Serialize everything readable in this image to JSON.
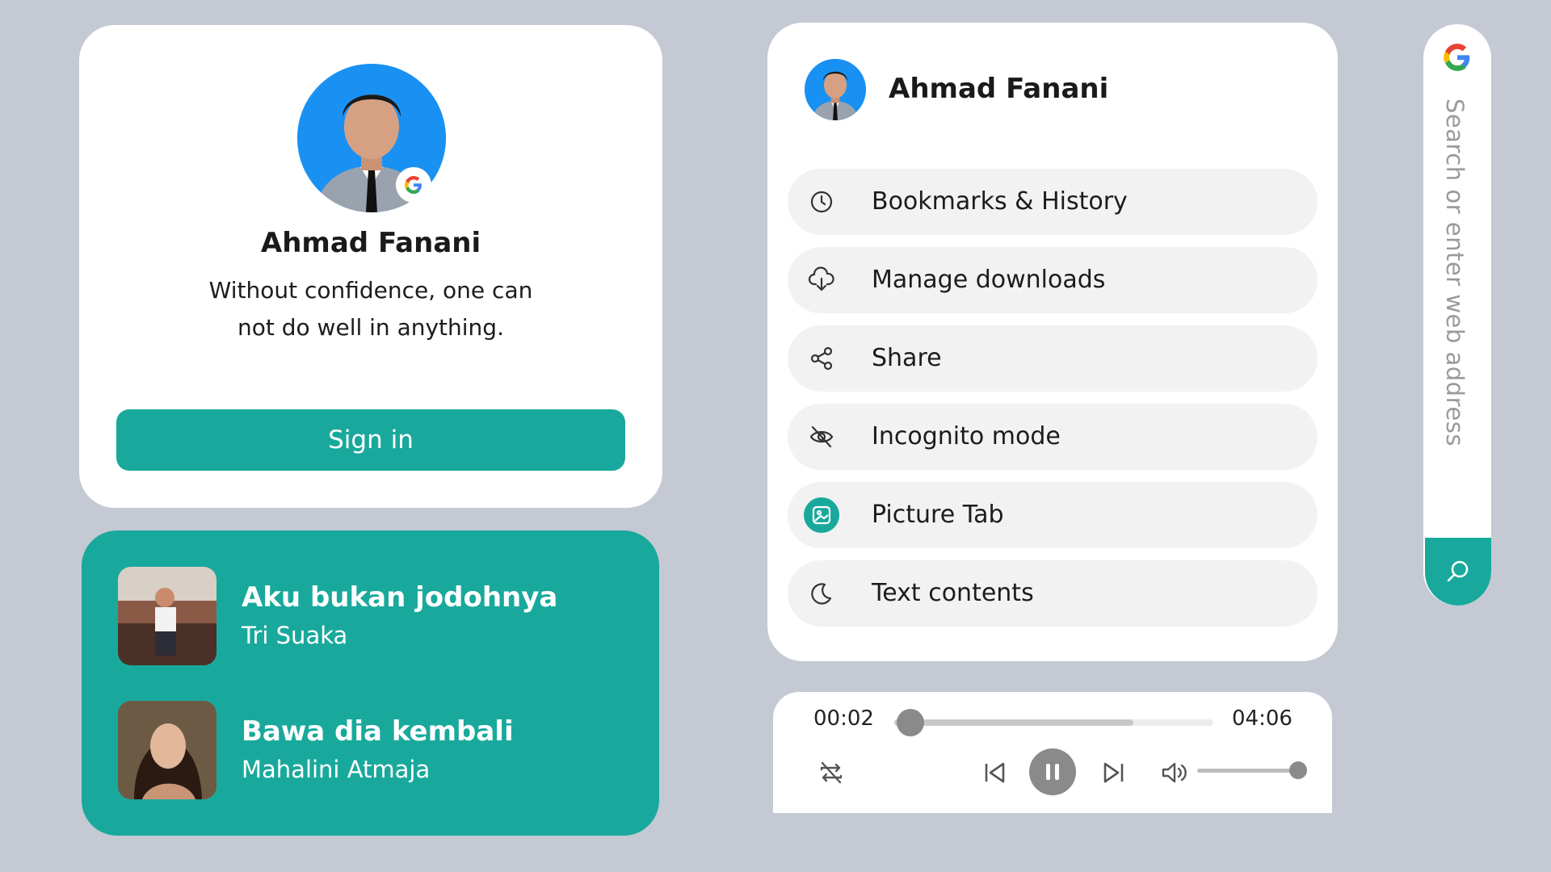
{
  "profile_card": {
    "name": "Ahmad Fanani",
    "quote": "Without confidence, one can not do well in anything.",
    "signin_label": "Sign in"
  },
  "playlist": {
    "songs": [
      {
        "title": "Aku bukan jodohnya",
        "artist": "Tri Suaka"
      },
      {
        "title": "Bawa dia kembali",
        "artist": "Mahalini Atmaja"
      }
    ]
  },
  "menu": {
    "username": "Ahmad Fanani",
    "items": [
      {
        "label": "Bookmarks & History",
        "icon": "clock-icon"
      },
      {
        "label": "Manage downloads",
        "icon": "cloud-download-icon"
      },
      {
        "label": "Share",
        "icon": "share-icon"
      },
      {
        "label": "Incognito mode",
        "icon": "eye-off-icon"
      },
      {
        "label": "Picture Tab",
        "icon": "image-icon",
        "active": true
      },
      {
        "label": "Text contents",
        "icon": "moon-icon"
      }
    ]
  },
  "player": {
    "current_time": "00:02",
    "total_time": "04:06",
    "progress": 0.008,
    "buffered": 0.75,
    "volume": 1.0
  },
  "search": {
    "placeholder": "Search or enter web address"
  },
  "colors": {
    "accent": "#19a99c",
    "background": "#c4c9d4",
    "card": "#ffffff",
    "menu_item": "#f2f2f3"
  }
}
